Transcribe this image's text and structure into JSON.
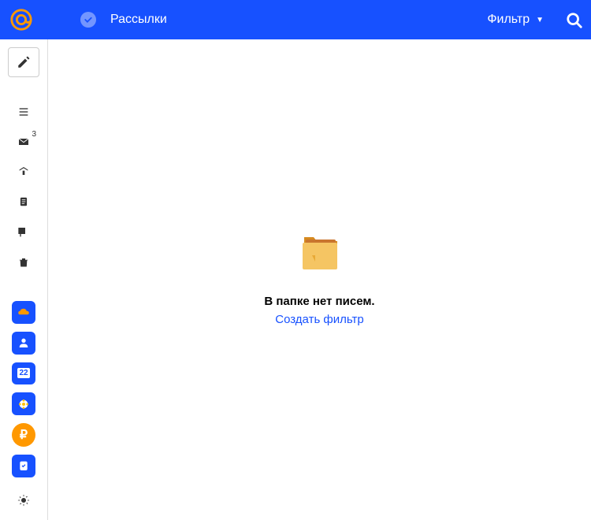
{
  "header": {
    "title": "Рассылки",
    "filter_label": "Фильтр"
  },
  "sidebar": {
    "inbox_badge": "3",
    "calendar_day": "22"
  },
  "content": {
    "empty_message": "В папке нет писем.",
    "create_filter_link": "Создать фильтр"
  }
}
